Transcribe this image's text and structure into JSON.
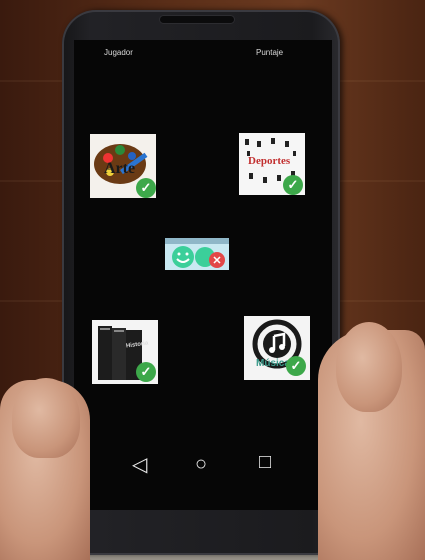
{
  "header": {
    "left_label": "Jugador",
    "right_label": "Puntaje"
  },
  "tiles": [
    {
      "label": "Arte",
      "status": "correct",
      "status_color": "#3da84a"
    },
    {
      "label": "Deportes",
      "status": "correct",
      "status_color": "#3da84a"
    },
    {
      "label": "",
      "status": "wrong",
      "status_color": "#e24848"
    },
    {
      "label": "Historia",
      "status": "correct",
      "status_color": "#3da84a"
    },
    {
      "label": "Música",
      "status": "correct",
      "status_color": "#3da84a"
    }
  ],
  "navbar": {
    "back_glyph": "◁",
    "home_glyph": "○",
    "recents_glyph": "□"
  },
  "icons": {
    "correct": "✓",
    "wrong": "✕"
  }
}
